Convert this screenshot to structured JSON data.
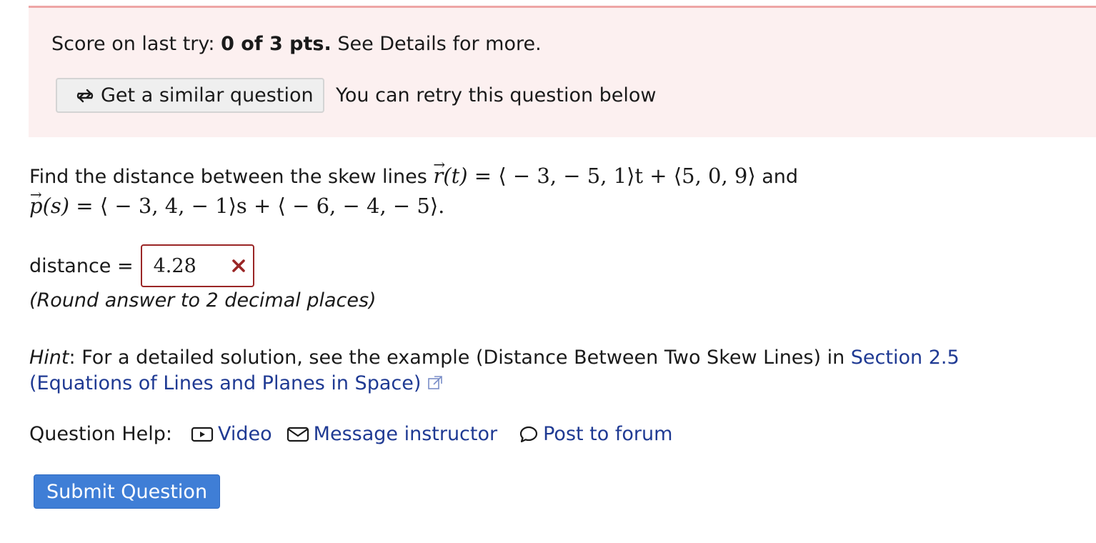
{
  "score_banner": {
    "prefix": "Score on last try: ",
    "score": "0 of 3 pts.",
    "suffix": " See Details for more.",
    "similar_button_label": "Get a similar question",
    "similar_button_icon": "retry-icon",
    "retry_text": "You can retry this question below"
  },
  "question": {
    "intro": "Find the distance between the skew lines ",
    "r_name": "r",
    "r_param": "(t)",
    "r_expr": " = ⟨ − 3,  − 5, 1⟩t + ⟨5, 0, 9⟩",
    "and": " and",
    "p_name": "p",
    "p_param": "(s)",
    "p_expr": " = ⟨ − 3, 4,  − 1⟩s + ⟨ − 6,  − 4,  − 5⟩."
  },
  "answer": {
    "label": "distance =",
    "value": "4.28",
    "status_icon": "incorrect-x-icon",
    "status_color": "#9a2626",
    "round_note": "(Round answer to 2 decimal places)"
  },
  "hint": {
    "label": "Hint",
    "text": ": For a detailed solution, see the example (Distance Between Two Skew Lines) in ",
    "link_text": "Section 2.5 (Equations of Lines and Planes in Space)",
    "link_icon": "external-link-icon",
    "link_color": "#1f3a93"
  },
  "help": {
    "label": "Question Help:",
    "video_label": "Video",
    "video_icon": "play-video-icon",
    "message_label": "Message instructor",
    "message_icon": "envelope-icon",
    "forum_label": "Post to forum",
    "forum_icon": "speech-bubble-icon"
  },
  "submit": {
    "label": "Submit Question",
    "color": "#3f7ed6"
  }
}
